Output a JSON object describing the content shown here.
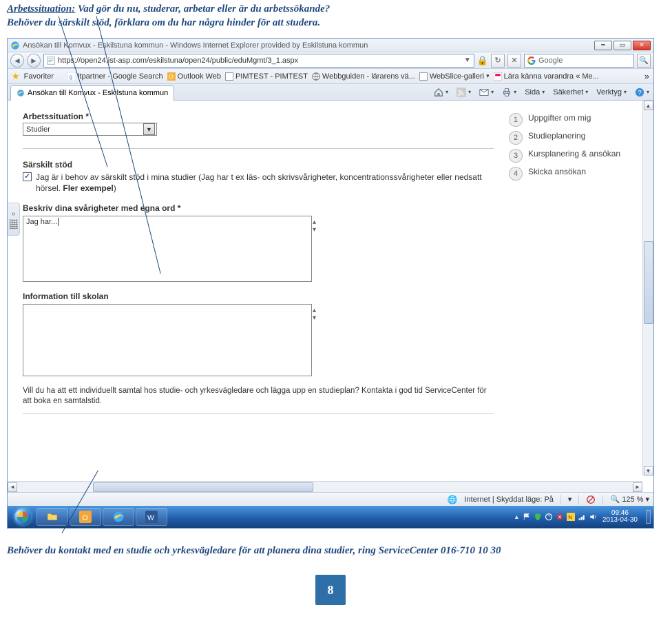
{
  "annotations": {
    "top_label": "Arbetssituation:",
    "top_rest": "  Vad gör du nu, studerar, arbetar eller är du arbetssökande?",
    "top_line2": "Behöver du särskilt stöd, förklara om du har några hinder för att studera.",
    "bottom": "Behöver du kontakt med en studie och yrkesvägledare för att planera dina studier, ring ServiceCenter  016-710 10 30",
    "page_number": "8"
  },
  "browser": {
    "title": "Ansökan till Komvux - Eskilstuna kommun - Windows Internet Explorer provided by Eskilstuna kommun",
    "url": "https://open24.ist-asp.com/eskilstuna/open24/public/eduMgmt/3_1.aspx",
    "search_placeholder": "Google",
    "refresh": "↻",
    "stop": "✕"
  },
  "favbar": {
    "favoriter": "Favoriter",
    "itpartner": "itpartner - Google Search",
    "outlook": "Outlook Web",
    "pimtest": "PIMTEST - PIMTEST",
    "webbguiden": "Webbguiden - lärarens vä...",
    "webslice": "WebSlice-galleri",
    "lara": "Lära känna varandra « Me...",
    "overflow": "»"
  },
  "tab": {
    "label": "Ansökan till Komvux - Eskilstuna kommun"
  },
  "toolbar": {
    "sida": "Sida",
    "sakerhet": "Säkerhet",
    "verktyg": "Verktyg"
  },
  "form": {
    "arbetssituation_label": "Arbetssituation *",
    "arbetssituation_value": "Studier",
    "sarskilt_title": "Särskilt stöd",
    "sarskilt_text": "Jag är i behov av särskilt stöd i mina studier (Jag har t ex läs- och skrivsvårigheter, koncentrationssvårigheter eller nedsatt hörsel. ",
    "fler_exempel": "Fler exempel",
    "closing": ")",
    "beskriv_label": "Beskriv dina svårigheter med egna ord *",
    "beskriv_value": "Jag har...",
    "info_label": "Information till skolan",
    "samtal_text": "Vill du ha att ett individuellt samtal hos studie- och yrkesvägledare och lägga upp en studieplan? Kontakta i god tid ServiceCenter för att boka en samtalstid."
  },
  "steps": {
    "s1": "Uppgifter om mig",
    "s2": "Studieplanering",
    "s3": "Kursplanering & ansökan",
    "s4": "Skicka ansökan"
  },
  "status": {
    "zone": "Internet | Skyddat läge: På",
    "zoom": "125 %"
  },
  "tray": {
    "time": "09:46",
    "date": "2013-04-30"
  }
}
